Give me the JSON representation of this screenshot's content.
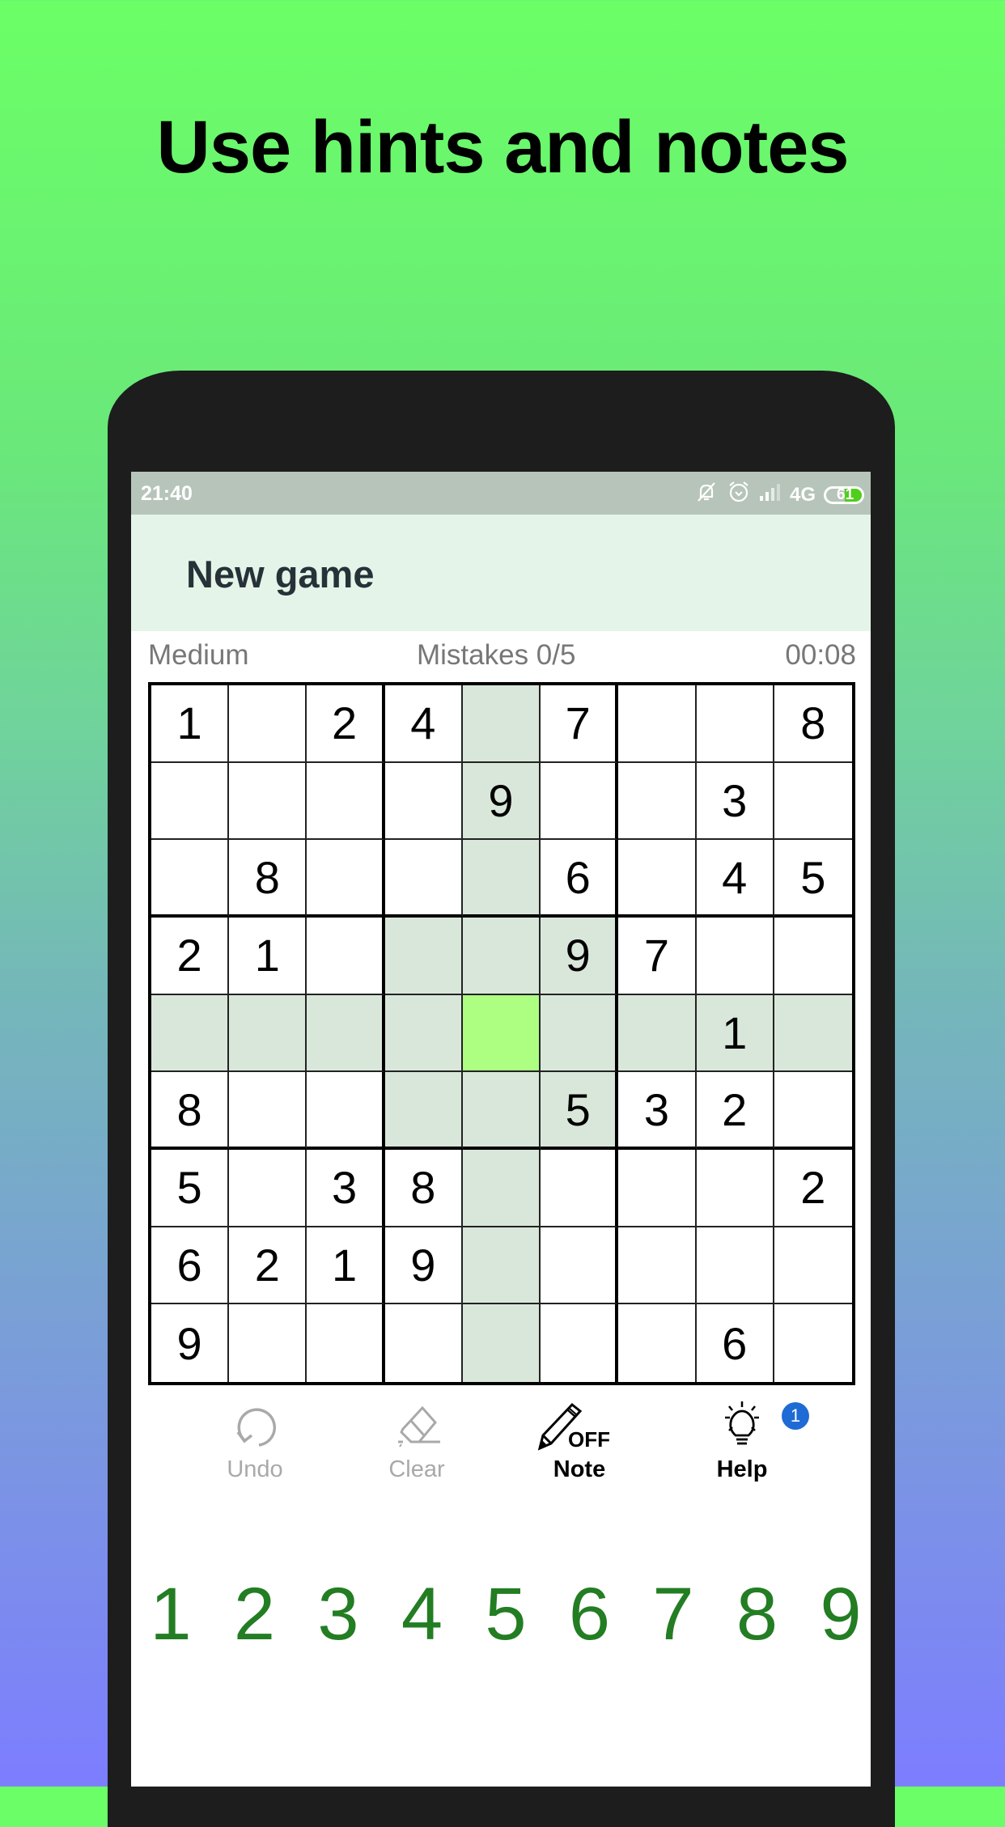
{
  "headline": "Use hints and notes",
  "status_bar": {
    "time": "21:40",
    "network": "4G",
    "battery_percent": "61",
    "icons": [
      "notifications-off-icon",
      "alarm-icon",
      "signal-icon",
      "battery-icon"
    ]
  },
  "app_bar": {
    "title": "New game"
  },
  "info": {
    "difficulty": "Medium",
    "mistakes": "Mistakes 0/5",
    "timer": "00:08"
  },
  "board": {
    "selected": {
      "row": 4,
      "col": 4
    },
    "cells": [
      [
        "1",
        "",
        "2",
        "4",
        "",
        "7",
        "",
        "",
        "8"
      ],
      [
        "",
        "",
        "",
        "",
        "9",
        "",
        "",
        "3",
        ""
      ],
      [
        "",
        "8",
        "",
        "",
        "",
        "6",
        "",
        "4",
        "5"
      ],
      [
        "2",
        "1",
        "",
        "",
        "",
        "9",
        "7",
        "",
        ""
      ],
      [
        "",
        "",
        "",
        "",
        "",
        "",
        "",
        "1",
        ""
      ],
      [
        "8",
        "",
        "",
        "",
        "",
        "5",
        "3",
        "2",
        ""
      ],
      [
        "5",
        "",
        "3",
        "8",
        "",
        "",
        "",
        "",
        "2"
      ],
      [
        "6",
        "2",
        "1",
        "9",
        "",
        "",
        "",
        "",
        ""
      ],
      [
        "9",
        "",
        "",
        "",
        "",
        "",
        "",
        "6",
        ""
      ]
    ]
  },
  "colors": {
    "highlight": "#d9e7da",
    "selected": "#adff82",
    "numpad": "#237d23",
    "badge": "#1e6bd6"
  },
  "toolbar": {
    "undo": {
      "label": "Undo",
      "icon": "undo-icon",
      "enabled": false
    },
    "clear": {
      "label": "Clear",
      "icon": "eraser-icon",
      "enabled": false
    },
    "note": {
      "label": "Note",
      "icon": "pencil-icon",
      "state": "OFF"
    },
    "help": {
      "label": "Help",
      "icon": "lightbulb-icon",
      "badge": "1"
    }
  },
  "numpad": [
    "1",
    "2",
    "3",
    "4",
    "5",
    "6",
    "7",
    "8",
    "9"
  ]
}
